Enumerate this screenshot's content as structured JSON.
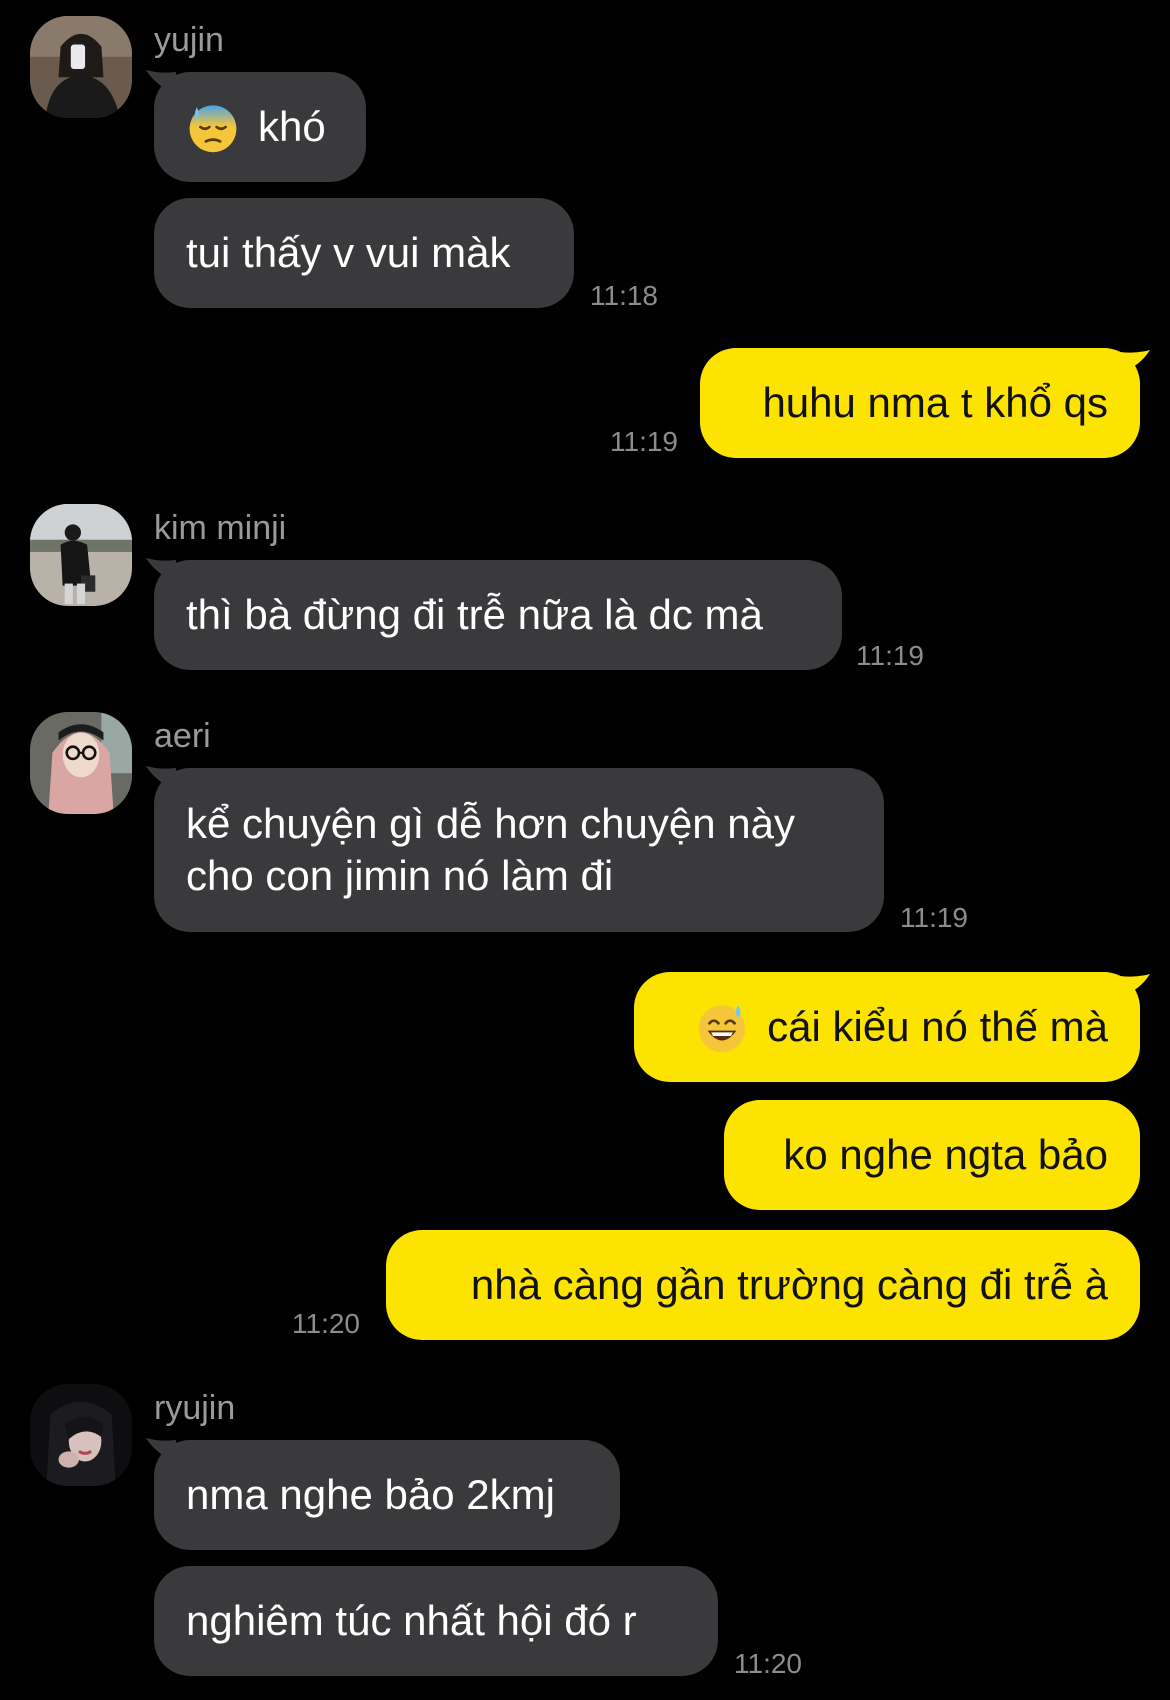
{
  "messages": [
    {
      "sender": "yujin",
      "bubbles": [
        {
          "icon": "downcast-face-with-sweat-emoji",
          "text": "khó"
        },
        {
          "text": "tui thấy v vui màk"
        }
      ],
      "time": "11:18"
    },
    {
      "sender": "me",
      "bubbles": [
        {
          "text": "huhu nma t khổ qs"
        }
      ],
      "time": "11:19"
    },
    {
      "sender": "kim minji",
      "bubbles": [
        {
          "text": "thì bà đừng đi trễ nữa là dc mà"
        }
      ],
      "time": "11:19"
    },
    {
      "sender": "aeri",
      "bubbles": [
        {
          "text": "kể chuyện gì dễ hơn chuyện này cho con jimin nó làm đi"
        }
      ],
      "time": "11:19"
    },
    {
      "sender": "me",
      "bubbles": [
        {
          "icon": "grinning-face-with-sweat-emoji",
          "text": "cái kiểu nó thế mà"
        },
        {
          "text": "ko nghe ngta bảo"
        },
        {
          "text": "nhà càng gần trường càng đi trễ à"
        }
      ],
      "time": "11:20"
    },
    {
      "sender": "ryujin",
      "bubbles": [
        {
          "text": "nma nghe bảo 2kmj"
        },
        {
          "text": "nghiêm túc nhất hội đó r"
        }
      ],
      "time": "11:20"
    }
  ],
  "colors": {
    "background": "#000000",
    "incoming_bubble": "#3a3a3c",
    "outgoing_bubble": "#fce300",
    "sender_name": "#9a9a9a",
    "timestamp": "#8c8c8c"
  }
}
